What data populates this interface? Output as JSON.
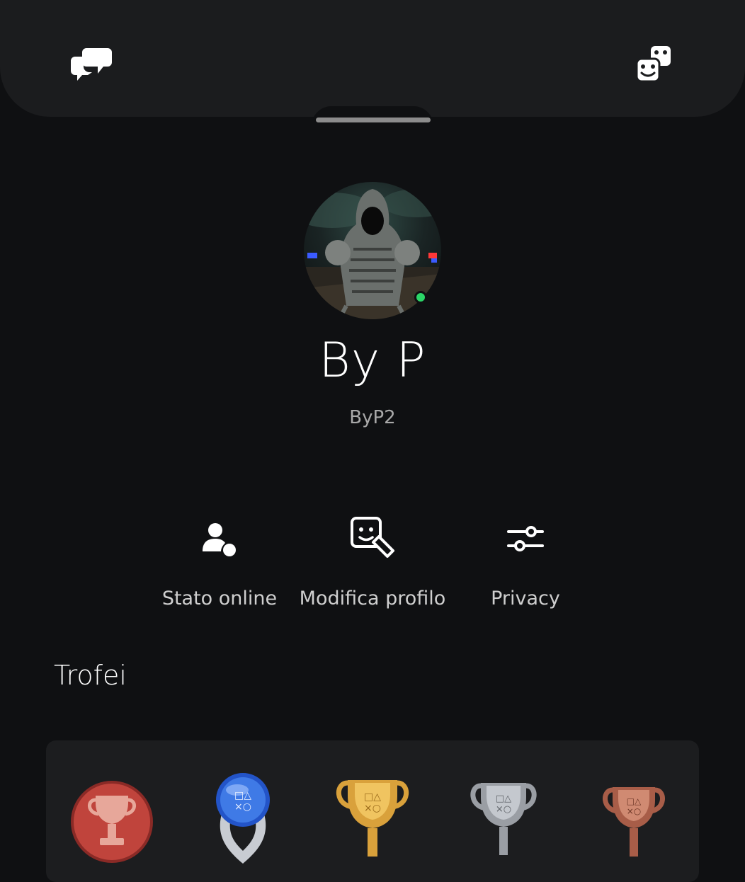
{
  "header": {
    "icons": [
      "chat-bubbles-icon",
      "party-dice-icon"
    ]
  },
  "profile": {
    "display_name": "By P",
    "online_id": "ByP2",
    "online_status_color": "#2bd567"
  },
  "actions": [
    {
      "label": "Stato online",
      "icon": "online-status-icon"
    },
    {
      "label": "Modifica profilo",
      "icon": "edit-profile-icon"
    },
    {
      "label": "Privacy",
      "icon": "sliders-icon"
    }
  ],
  "trophies": {
    "title": "Trofei",
    "items": [
      {
        "type": "level",
        "icon": "trophy-level-icon"
      },
      {
        "type": "platinum",
        "icon": "platinum-trophy-icon"
      },
      {
        "type": "gold",
        "icon": "gold-trophy-icon"
      },
      {
        "type": "silver",
        "icon": "silver-trophy-icon"
      },
      {
        "type": "bronze",
        "icon": "bronze-trophy-icon"
      }
    ]
  },
  "colors": {
    "background": "#0f1012",
    "sheet": "#1b1c1e",
    "card": "#1c1d1f"
  }
}
